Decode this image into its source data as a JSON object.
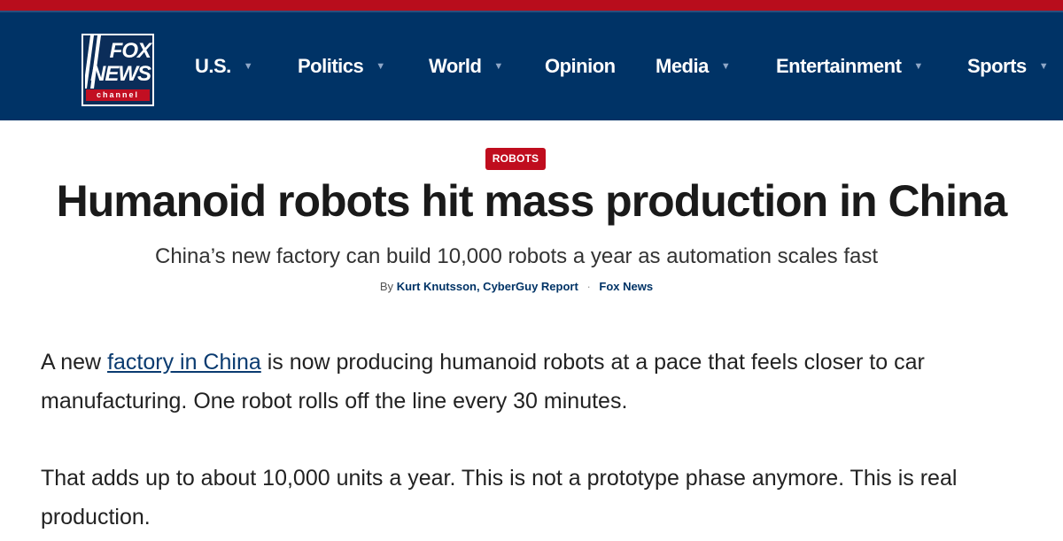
{
  "logo": {
    "line1": "FOX",
    "line2": "NEWS",
    "line3": "channel"
  },
  "nav": {
    "items": [
      {
        "label": "U.S.",
        "caret": "▼"
      },
      {
        "label": "Politics",
        "caret": "▼"
      },
      {
        "label": "World",
        "caret": "▼"
      },
      {
        "label": "Opinion",
        "caret": ""
      },
      {
        "label": "Media",
        "caret": "▼"
      },
      {
        "label": "Entertainment",
        "caret": "▼"
      },
      {
        "label": "Sports",
        "caret": "▼"
      }
    ]
  },
  "article": {
    "category": "ROBOTS",
    "title": "Humanoid robots hit mass production in China",
    "subtitle": "China’s new factory can build 10,000 robots a year as automation scales fast",
    "byline": {
      "prefix": "By",
      "author": "Kurt Knutsson, CyberGuy Report",
      "separator": "·",
      "source": "Fox News"
    },
    "paragraphs": [
      {
        "before": "A new ",
        "link": "factory in China",
        "after": " is now producing humanoid robots at a pace that feels closer to car manufacturing. One robot rolls off the line every 30 minutes."
      },
      {
        "text": "That adds up to about 10,000 units a year. This is not a prototype phase anymore. This is real production."
      }
    ]
  },
  "colors": {
    "header_bg": "#003366",
    "accent_red": "#c00d1e",
    "link": "#0a3b70"
  }
}
